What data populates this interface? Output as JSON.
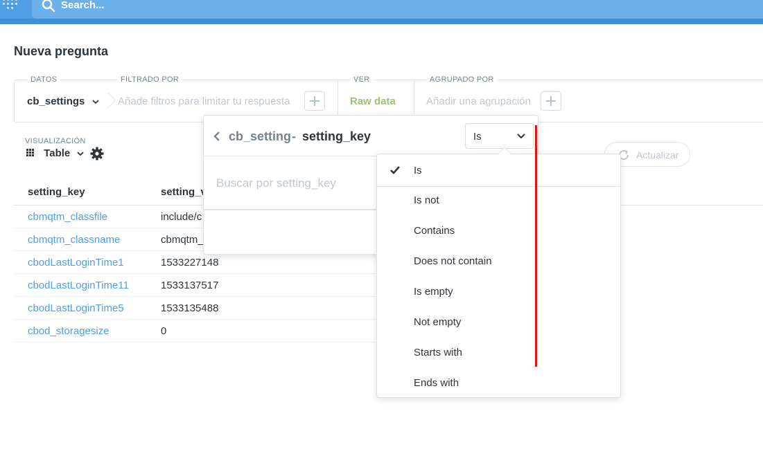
{
  "navbar": {
    "search_placeholder": "Search..."
  },
  "page": {
    "title": "Nueva pregunta"
  },
  "builder": {
    "data_label": "DATOS",
    "data_source": "cb_settings",
    "filter_label": "FILTRADO POR",
    "filter_hint": "Añade filtros para limitar tu respuesta",
    "view_label": "VER",
    "view_value": "Raw data",
    "group_label": "AGRUPADO POR",
    "group_hint": "Añadir una agrupación"
  },
  "visualization": {
    "label": "VISUALIZACIÓN",
    "type": "Table",
    "refresh_label": "Actualizar"
  },
  "table": {
    "columns": [
      "setting_key",
      "setting_v"
    ],
    "rows": [
      {
        "key": "cbmqtm_classfile",
        "value": "include/c"
      },
      {
        "key": "cbmqtm_classname",
        "value": "cbmqtm_"
      },
      {
        "key": "cbodLastLoginTime1",
        "value": "1533227148"
      },
      {
        "key": "cbodLastLoginTime11",
        "value": "1533137517"
      },
      {
        "key": "cbodLastLoginTime5",
        "value": "1533135488"
      },
      {
        "key": "cbod_storagesize",
        "value": "0"
      }
    ]
  },
  "filter_popover": {
    "table_name": "cb_setting",
    "separator": "-",
    "field_name": "setting_key",
    "operator": "Is",
    "search_placeholder": "Buscar por setting_key"
  },
  "operator_dropdown": {
    "selected": "Is",
    "options": [
      "Is",
      "Is not",
      "Contains",
      "Does not contain",
      "Is empty",
      "Not empty",
      "Starts with",
      "Ends with"
    ]
  },
  "colors": {
    "brand_blue": "#509ee3",
    "raw_data_green": "#9cc177",
    "annotation_red": "#e5130f"
  },
  "icons": [
    "logo-icon",
    "search-icon",
    "chevron-down-icon",
    "plus-icon",
    "grid-icon",
    "gear-icon",
    "refresh-icon",
    "chevron-left-icon",
    "check-icon"
  ]
}
